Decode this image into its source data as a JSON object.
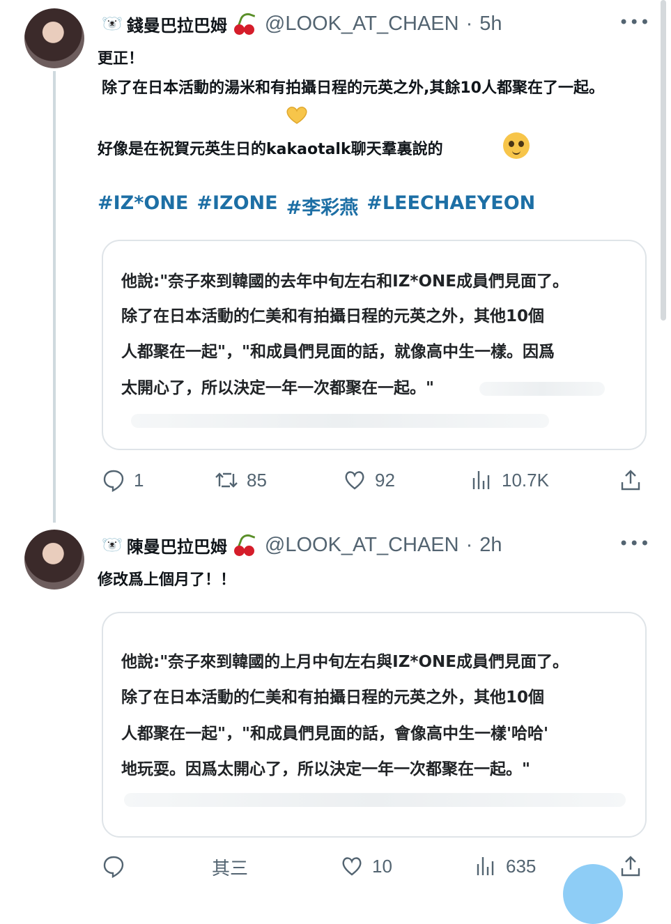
{
  "tweets": [
    {
      "display_name": "錢曼巴拉巴姆",
      "handle": "@LOOK_AT_CHAEN",
      "separator": "·",
      "time": "5h",
      "more": "•••",
      "lines": [
        "更正！",
        "除了在日本活動的湯米和有拍攝日程的元英之外,其餘10人都聚在了一起。",
        "好像是在祝賀元英生日的kakaotalk聊天羣裏說的"
      ],
      "hashtags": [
        "#IZ*ONE",
        "#IZONE",
        "#李彩燕",
        "#LEECHAEYEON"
      ],
      "card_lines": [
        "他說:\"奈子來到韓國的去年中旬左右和IZ*ONE成員們見面了。",
        "除了在日本活動的仁美和有拍攝日程的元英之外，其他10個",
        "人都聚在一起\"，\"和成員們見面的話，就像高中生一樣。因爲",
        "太開心了，所以決定一年一次都聚在一起。\""
      ],
      "actions": {
        "replies": "1",
        "retweets": "85",
        "likes": "92",
        "views": "10.7K"
      }
    },
    {
      "display_name": "陳曼巴拉巴姆",
      "handle": "@LOOK_AT_CHAEN",
      "separator": "·",
      "time": "2h",
      "more": "•••",
      "lines": [
        "修改爲上個月了！！"
      ],
      "card_lines": [
        "他說:\"奈子來到韓國的上月中旬左右與IZ*ONE成員們見面了。",
        "除了在日本活動的仁美和有拍攝日程的元英之外，其他10個",
        "人都聚在一起\"，\"和成員們見面的話，會像高中生一樣'哈哈'",
        "地玩耍。因爲太開心了，所以決定一年一次都聚在一起。\""
      ],
      "actions": {
        "replies": "",
        "retweets": "其三",
        "likes": "10",
        "views": "635"
      }
    }
  ],
  "colors": {
    "hashtag": "#1d6fa5",
    "muted": "#536471",
    "fab": "#8ecdf6"
  }
}
